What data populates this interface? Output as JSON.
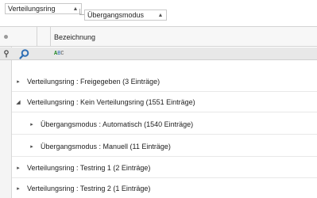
{
  "group_panel": {
    "chips": [
      {
        "label": "Verteilungsring",
        "sort": "▲"
      },
      {
        "label": "Übergangsmodus",
        "sort": "▲"
      }
    ]
  },
  "grid": {
    "columns": [
      {
        "header": "Bezeichnung"
      }
    ],
    "filter_row": {
      "search_icon": "search-icon",
      "condition_icon": "begins-with-abc-icon",
      "abc_text": {
        "a": "A",
        "b": "B",
        "c": "C"
      }
    },
    "group_rows": [
      {
        "level": 0,
        "expanded": false,
        "expander": "▸",
        "text": "Verteilungsring : Freigegeben (3 Einträge)"
      },
      {
        "level": 0,
        "expanded": true,
        "expander": "◢",
        "text": "Verteilungsring : Kein Verteilungsring (1551 Einträge)"
      },
      {
        "level": 1,
        "expanded": false,
        "expander": "▸",
        "text": "Übergangsmodus : Automatisch (1540 Einträge)"
      },
      {
        "level": 1,
        "expanded": false,
        "expander": "▸",
        "text": "Übergangsmodus : Manuell (11 Einträge)"
      },
      {
        "level": 0,
        "expanded": false,
        "expander": "▸",
        "text": "Verteilungsring : Testring 1 (2 Einträge)"
      },
      {
        "level": 0,
        "expanded": false,
        "expander": "▸",
        "text": "Verteilungsring : Testring 2 (1 Einträge)"
      }
    ]
  },
  "colors": {
    "search_icon": "#2f6fb5",
    "border": "#d4d4d4",
    "header_bg": "#f7f7f7",
    "filter_bg": "#e8e8e8"
  }
}
